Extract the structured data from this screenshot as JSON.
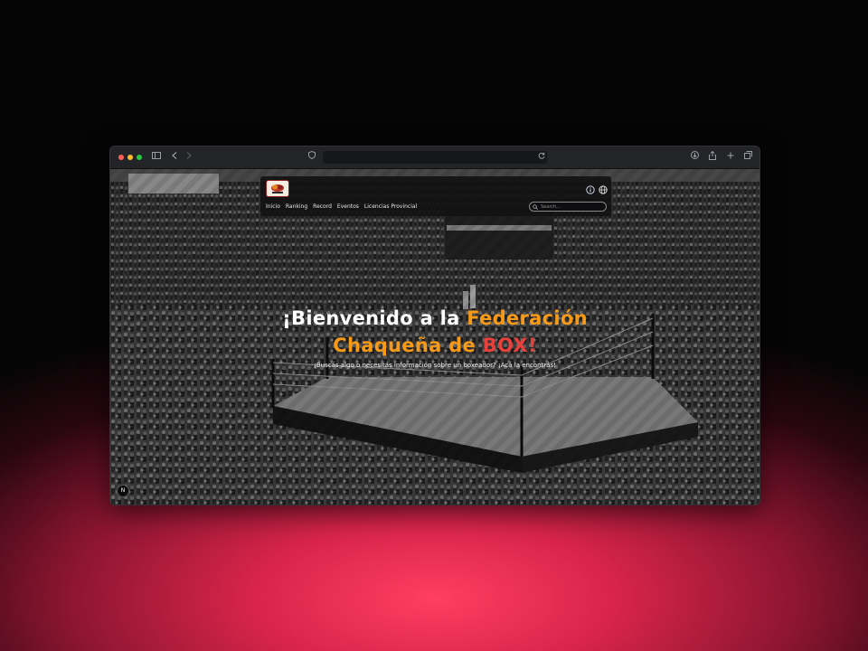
{
  "browser": {
    "address": "",
    "icons": [
      "sidebar-icon",
      "back-icon",
      "forward-icon",
      "shield-icon",
      "reload-icon",
      "download-icon",
      "share-icon",
      "new-tab-icon",
      "tabs-icon"
    ]
  },
  "nav": {
    "links": [
      "Inicio",
      "Ranking",
      "Record",
      "Eventos",
      "Licencias Provincial"
    ],
    "search_placeholder": "Search..."
  },
  "hero": {
    "title_part1": "¡Bienvenido a la ",
    "title_part2": "Federación",
    "title_part3": "Chaqueña de ",
    "title_part4": "BOX!",
    "subtitle": "¡Buscás algo o necesitás información sobre un boxeador? ¡Acá la encontrás!"
  },
  "badge": {
    "label": "N"
  },
  "colors": {
    "accent_orange": "#f79a18",
    "accent_red": "#e8403a",
    "page_glow": "#ff3e62"
  }
}
